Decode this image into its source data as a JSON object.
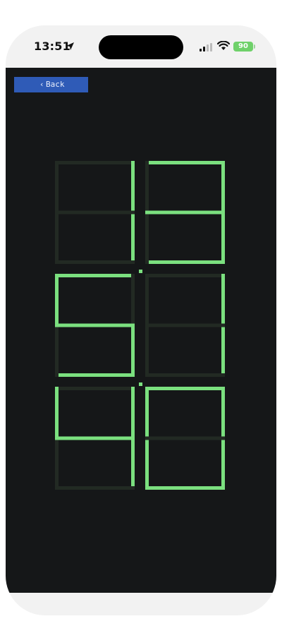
{
  "status_bar": {
    "time": "13:51",
    "battery": "90"
  },
  "toolbar": {
    "back_label": "Back"
  },
  "display": {
    "digits": [
      "1",
      "3",
      "5",
      "1",
      "4",
      "0"
    ],
    "on_color": "#7be07f",
    "off_color": "#222a23",
    "colon_color": "#7be07f"
  }
}
